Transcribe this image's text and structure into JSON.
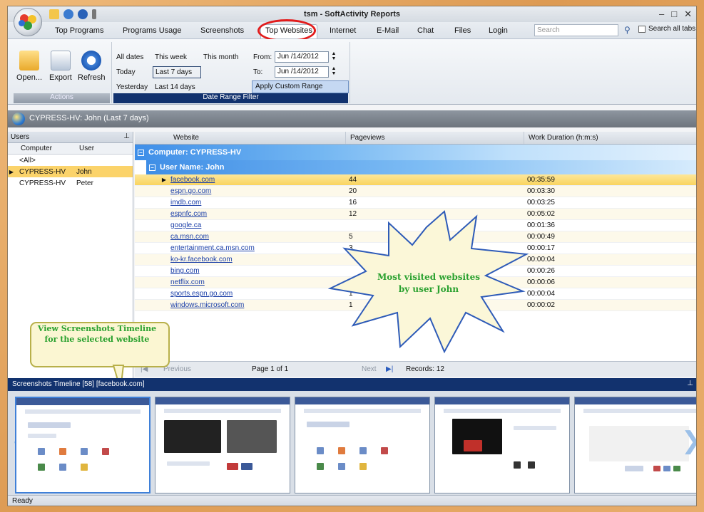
{
  "window": {
    "title": "tsm - SoftActivity Reports"
  },
  "tabs": [
    "Top Programs",
    "Programs Usage",
    "Screenshots",
    "Top Websites",
    "Internet",
    "E-Mail",
    "Chat",
    "Files",
    "Login"
  ],
  "active_tab": "Top Websites",
  "search": {
    "placeholder": "Search",
    "search_all_label": "Search all tabs"
  },
  "ribbon": {
    "actions": {
      "open": "Open...",
      "export": "Export",
      "refresh": "Refresh",
      "group_label": "Actions"
    },
    "dates": {
      "all_dates": "All dates",
      "this_week": "This week",
      "this_month": "This month",
      "today": "Today",
      "last_7_days": "Last 7 days",
      "yesterday": "Yesterday",
      "last_14_days": "Last 14 days",
      "selected": "Last 7 days",
      "from_label": "From:",
      "to_label": "To:",
      "from_value": "Jun /14/2012",
      "to_value": "Jun /14/2012",
      "apply": "Apply Custom Range",
      "group_label": "Date Range Filter"
    }
  },
  "header": {
    "text": "CYPRESS-HV: John (Last 7 days)"
  },
  "users_panel": {
    "title": "Users",
    "columns": [
      "Computer",
      "User"
    ],
    "rows": [
      {
        "computer": "<All>",
        "user": ""
      },
      {
        "computer": "CYPRESS-HV",
        "user": "John"
      },
      {
        "computer": "CYPRESS-HV",
        "user": "Peter"
      }
    ],
    "selected_index": 1
  },
  "grid": {
    "columns": [
      "Website",
      "Pageviews",
      "Work Duration (h:m:s)"
    ],
    "group_computer": "Computer: CYPRESS-HV",
    "group_user": "User Name: John",
    "rows": [
      {
        "site": "facebook.com",
        "views": "44",
        "duration": "00:35:59"
      },
      {
        "site": "espn.go.com",
        "views": "20",
        "duration": "00:03:30"
      },
      {
        "site": "imdb.com",
        "views": "16",
        "duration": "00:03:25"
      },
      {
        "site": "espnfc.com",
        "views": "12",
        "duration": "00:05:02"
      },
      {
        "site": "google.ca",
        "views": "",
        "duration": "00:01:36"
      },
      {
        "site": "ca.msn.com",
        "views": "5",
        "duration": "00:00:49"
      },
      {
        "site": "entertainment.ca.msn.com",
        "views": "3",
        "duration": "00:00:17"
      },
      {
        "site": "ko-kr.facebook.com",
        "views": "",
        "duration": "00:00:04"
      },
      {
        "site": "bing.com",
        "views": "",
        "duration": "00:00:26"
      },
      {
        "site": "netflix.com",
        "views": "1",
        "duration": "00:00:06"
      },
      {
        "site": "sports.espn.go.com",
        "views": "1",
        "duration": "00:00:04"
      },
      {
        "site": "windows.microsoft.com",
        "views": "1",
        "duration": "00:00:02"
      }
    ]
  },
  "pager": {
    "previous": "Previous",
    "page": "Page 1 of 1",
    "next": "Next",
    "records": "Records: 12"
  },
  "callouts": {
    "star": "Most visited websites by user John",
    "tip": "View Screenshots Timeline for the selected website"
  },
  "timeline": {
    "title": "Screenshots Timeline [58] [facebook.com]",
    "thumb_count": 5
  },
  "status": {
    "text": "Ready"
  },
  "colors": {
    "accent": "#12326e",
    "selected_row": "#f9d45f",
    "callout_text": "#2aa12f",
    "highlight_ring": "#e21b1b"
  }
}
